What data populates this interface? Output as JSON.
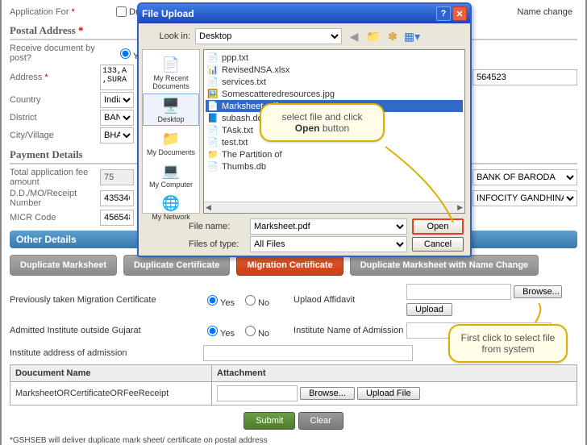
{
  "form": {
    "application_for": {
      "label": "Application For",
      "options": [
        "Dup",
        "Name change"
      ]
    },
    "postal": {
      "heading": "Postal Address",
      "receive_label": "Receive document by post?",
      "address_label": "Address",
      "address_value": "133,A\n,SURA",
      "pin_value": "564523",
      "country_label": "Country",
      "country_value": "India",
      "district_label": "District",
      "district_value": "BANA",
      "city_label": "City/Village",
      "city_value": "BHAC"
    },
    "payment": {
      "heading": "Payment Details",
      "fee_label": "Total application fee amount",
      "fee_value": "75",
      "bank_value": "BANK OF BARODA",
      "dd_label": "D.D./MO/Receipt Number",
      "dd_value": "435346",
      "branch_value": "INFOCITY GANDHINAGA",
      "micr_label": "MICR Code",
      "micr_value": "456548"
    },
    "other_heading": "Other Details",
    "yes": "Yes",
    "no": "No"
  },
  "tabs": [
    "Duplicate Marksheet",
    "Duplicate Certificate",
    "Migration Certificate",
    "Duplicate Marksheet with Name Change"
  ],
  "migration": {
    "prev_label": "Previously taken Migration Certificate",
    "affidavit_label": "Uplaod Affidavit",
    "outside_label": "Admitted Institute outside Gujarat",
    "inst_name_label": "Institute Name of Admission",
    "inst_addr_label": "Institute address of admission"
  },
  "doc_table": {
    "headers": [
      "Doucument Name",
      "Attachment"
    ],
    "rows": [
      {
        "name": "MarksheetORCertificateORFeeReceipt"
      }
    ]
  },
  "buttons": {
    "browse": "Browse...",
    "upload": "Upload",
    "upload_file": "Upload File",
    "submit": "Submit",
    "clear": "Clear"
  },
  "footnote": "*GSHSEB will deliver duplicate mark sheet/ certificate on postal address",
  "dialog": {
    "title": "File Upload",
    "lookin_label": "Look in:",
    "lookin_value": "Desktop",
    "places": [
      "My Recent Documents",
      "Desktop",
      "My Documents",
      "My Computer",
      "My Network"
    ],
    "files": [
      "ppp.txt",
      "RevisedNSA.xlsx",
      "services.txt",
      "Somescatteredresources.jpg",
      "Marksheet.pdf",
      "subash.docx",
      "TAsk.txt",
      "test.txt",
      "The Partition of",
      "Thumbs.db"
    ],
    "filename_label": "File name:",
    "filename_value": "Marksheet.pdf",
    "filetype_label": "Files of type:",
    "filetype_value": "All Files",
    "open_btn": "Open",
    "cancel_btn": "Cancel"
  },
  "callouts": {
    "open": {
      "line1": "select file and click",
      "bold": "Open",
      "line2": "button"
    },
    "browse": "First click to select file from system"
  }
}
